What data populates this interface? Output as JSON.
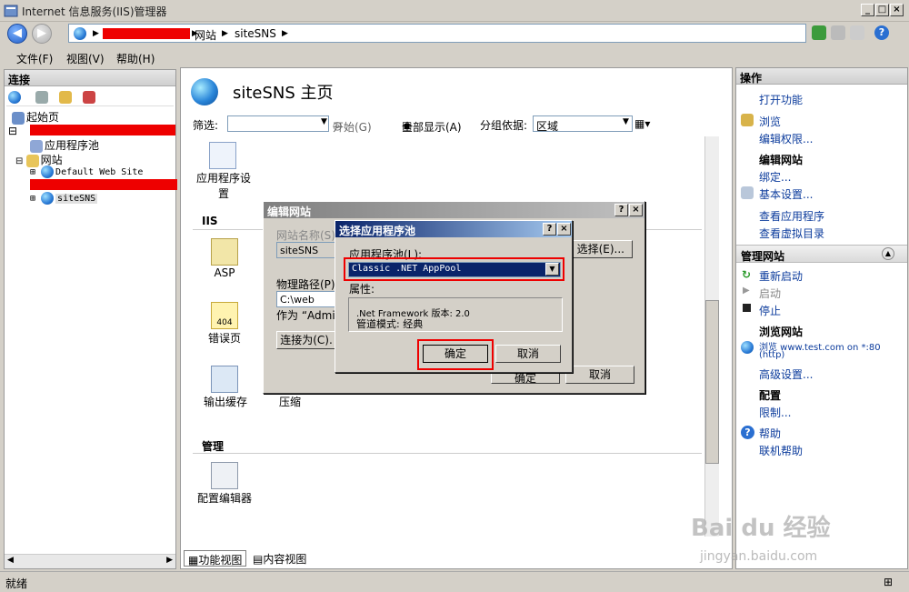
{
  "window": {
    "title": "Internet 信息服务(IIS)管理器"
  },
  "address": {
    "crumbs": [
      "网站",
      "siteSNS"
    ]
  },
  "menu": {
    "file": "文件(F)",
    "view": "视图(V)",
    "help": "帮助(H)"
  },
  "connections": {
    "header": "连接",
    "tree": {
      "start_page": "起始页",
      "app_pools": "应用程序池",
      "sites": "网站",
      "default_site": "Default Web Site",
      "site_sns": "siteSNS"
    }
  },
  "center": {
    "title": "siteSNS 主页",
    "filter": {
      "label": "筛选:",
      "start": "开始(G)",
      "show_all": "全部显示(A)",
      "group_by": "分组依据:",
      "group_value": "区域"
    },
    "features": {
      "app_settings": "应用程序设置",
      "iis_header": "IIS",
      "asp": "ASP",
      "error_pages": "错误页",
      "output_cache": "输出缓存",
      "compression": "压缩",
      "manage_header": "管理",
      "config_editor": "配置编辑器"
    },
    "tabs": {
      "feature_view": "功能视图",
      "content_view": "内容视图"
    }
  },
  "actions": {
    "header": "操作",
    "open_feature": "打开功能",
    "browse": "浏览",
    "edit_permissions": "编辑权限...",
    "edit_site_header": "编辑网站",
    "bindings": "绑定...",
    "basic_settings": "基本设置...",
    "view_apps": "查看应用程序",
    "view_vdirs": "查看虚拟目录",
    "manage_site_header": "管理网站",
    "restart": "重新启动",
    "start": "启动",
    "stop": "停止",
    "browse_site_header": "浏览网站",
    "browse_url_line1": "浏览 www.test.com on *:80",
    "browse_url_line2": "(http)",
    "advanced_settings": "高级设置...",
    "config_header": "配置",
    "limits": "限制...",
    "help": "帮助",
    "online_help": "联机帮助"
  },
  "status": {
    "text": "就绪"
  },
  "edit_site_dialog": {
    "title": "编辑网站",
    "site_name_label": "网站名称(S)",
    "site_name_value": "siteSNS",
    "select_button": "选择(E)...",
    "physical_path_label": "物理路径(P)",
    "physical_path_value": "C:\\web",
    "pass_through": "作为 “Admin",
    "connect_as": "连接为(C).",
    "ok_partial": "确定",
    "cancel": "取消"
  },
  "select_pool_dialog": {
    "title": "选择应用程序池",
    "pool_label": "应用程序池(L):",
    "pool_value": "Classic .NET AppPool",
    "properties_label": "属性:",
    "net_version": ".Net Framework 版本: 2.0",
    "pipeline_mode": "管道模式: 经典",
    "ok": "确定",
    "cancel": "取消"
  },
  "watermark": {
    "line1": "Bai du 经验",
    "line2": "jingyan.baidu.com"
  },
  "colors": {
    "title_active": "#0a246a",
    "title_inactive": "#808080",
    "highlight": "#e00000",
    "link": "#0b3b9c"
  }
}
